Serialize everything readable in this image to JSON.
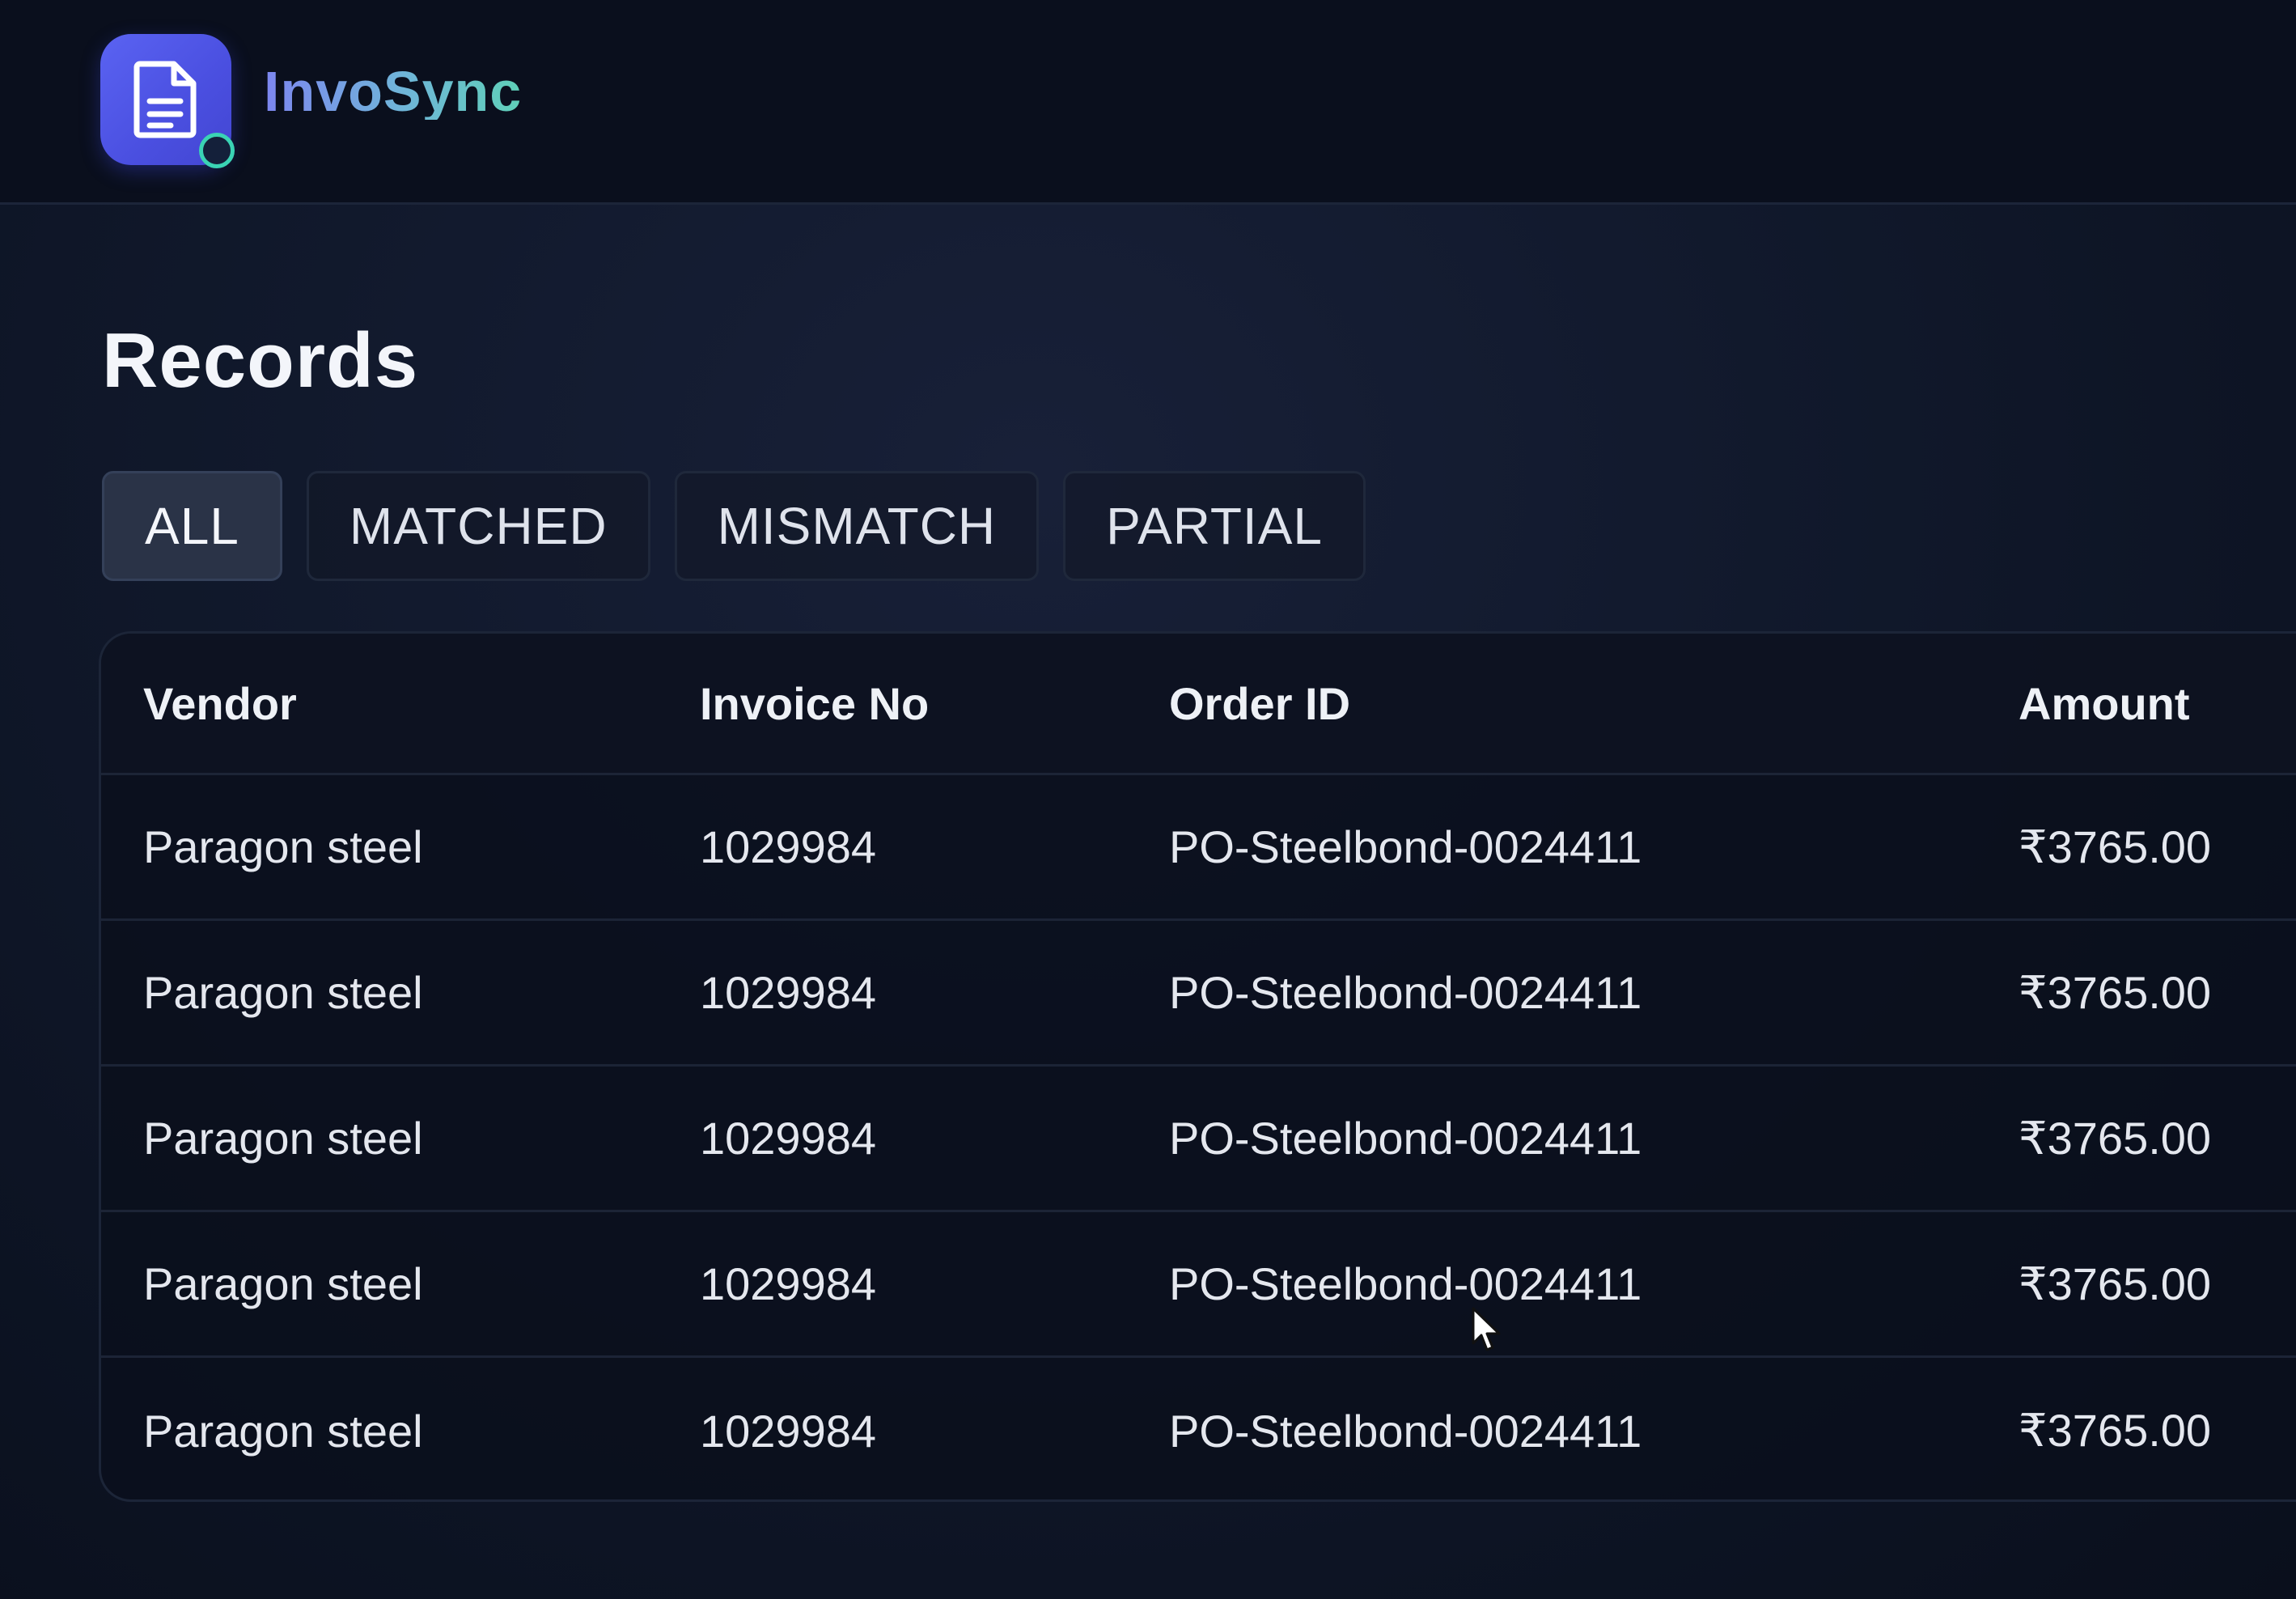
{
  "app": {
    "brand_name": "InvoSync",
    "logo_icon": "document-icon",
    "accent_color": "#4f56e8",
    "brand_gradient": [
      "#7d86f0",
      "#5fd0b8"
    ]
  },
  "page": {
    "title": "Records"
  },
  "tabs": [
    {
      "label": "ALL",
      "active": true
    },
    {
      "label": "MATCHED",
      "active": false
    },
    {
      "label": "MISMATCH",
      "active": false
    },
    {
      "label": "PARTIAL",
      "active": false
    }
  ],
  "table": {
    "columns": [
      "Vendor",
      "Invoice No",
      "Order ID",
      "Amount"
    ],
    "rows": [
      {
        "vendor": "Paragon steel",
        "invoice_no": "1029984",
        "order_id": "PO-Steelbond-0024411",
        "amount": "₹3765.00"
      },
      {
        "vendor": "Paragon steel",
        "invoice_no": "1029984",
        "order_id": "PO-Steelbond-0024411",
        "amount": "₹3765.00"
      },
      {
        "vendor": "Paragon steel",
        "invoice_no": "1029984",
        "order_id": "PO-Steelbond-0024411",
        "amount": "₹3765.00"
      },
      {
        "vendor": "Paragon steel",
        "invoice_no": "1029984",
        "order_id": "PO-Steelbond-0024411",
        "amount": "₹3765.00"
      },
      {
        "vendor": "Paragon steel",
        "invoice_no": "1029984",
        "order_id": "PO-Steelbond-0024411",
        "amount": "₹3765.00"
      }
    ]
  }
}
